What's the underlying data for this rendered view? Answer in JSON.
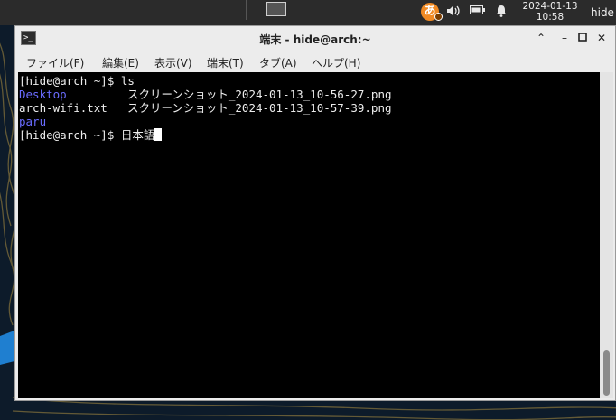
{
  "panel": {
    "ime_label": "あ",
    "clock_date": "2024-01-13",
    "clock_time": "10:58",
    "user": "hide"
  },
  "window": {
    "title": "端末 - hide@arch:~",
    "menu": [
      {
        "label": "ファイル(F)"
      },
      {
        "label": "編集(E)"
      },
      {
        "label": "表示(V)"
      },
      {
        "label": "端末(T)"
      },
      {
        "label": "タブ(A)"
      },
      {
        "label": "ヘルプ(H)"
      }
    ]
  },
  "terminal": {
    "prompt1": "[hide@arch ~]$ ",
    "cmd1": "ls",
    "files": {
      "desktop": "Desktop",
      "screenshot1": "スクリーンショット_2024-01-13_10-56-27.png",
      "archwifi": "arch-wifi.txt",
      "screenshot2": "スクリーンショット_2024-01-13_10-57-39.png",
      "paru": "paru"
    },
    "prompt2": "[hide@arch ~]$ ",
    "input": "日本語"
  },
  "colors": {
    "dir": "#6a6cff",
    "terminal_bg": "#000000",
    "ime": "#f08a24"
  }
}
